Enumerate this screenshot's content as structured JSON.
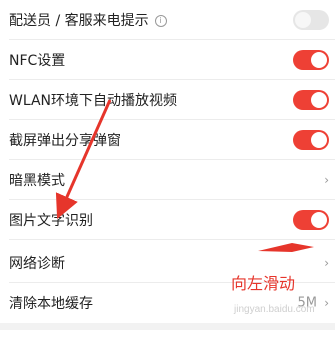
{
  "settings": {
    "rows": [
      {
        "label": "配送员 / 客服来电提示",
        "control": "toggle-off",
        "has_info": true
      },
      {
        "label": "NFC设置",
        "control": "toggle-on"
      },
      {
        "label": "WLAN环境下自动播放视频",
        "control": "toggle-on"
      },
      {
        "label": "截屏弹出分享弹窗",
        "control": "toggle-on"
      },
      {
        "label": "暗黑模式",
        "control": "chevron"
      },
      {
        "label": "图片文字识别",
        "control": "toggle-on"
      },
      {
        "label": "网络诊断",
        "control": "chevron"
      },
      {
        "label": "清除本地缓存",
        "control": "value-chevron",
        "value": "5M"
      }
    ]
  },
  "annotation": {
    "text": "向左滑动",
    "color": "#e6352b"
  },
  "watermark": {
    "text": "jingyan.baidu.com"
  },
  "colors": {
    "toggle_on": "#ee4035",
    "toggle_off": "#e6e6e6",
    "annotation_red": "#e6352b"
  }
}
